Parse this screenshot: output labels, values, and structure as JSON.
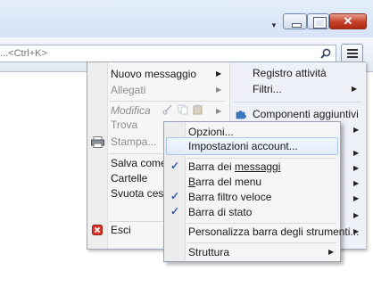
{
  "window": {
    "close_symbol": "✕"
  },
  "search": {
    "placeholder": "...<Ctrl+K>"
  },
  "menu": {
    "left": {
      "new_message": "Nuovo messaggio",
      "attachments": "Allegati",
      "edit": "Modifica",
      "find": "Trova",
      "print": "Stampa...",
      "save_as": "Salva come",
      "folders": "Cartelle",
      "empty_trash": "Svuota cestino",
      "exit": "Esci"
    },
    "right": {
      "activity_log": "Registro attività",
      "filters": "Filtri...",
      "addons": "Componenti aggiuntivi"
    }
  },
  "submenu": {
    "options": "Opzioni...",
    "account_settings": "Impostazioni account...",
    "message_bar_prefix": "Barra dei ",
    "message_bar_underlined": "messaggi",
    "menu_bar_underlined": "B",
    "menu_bar_rest": "arra del menu",
    "quick_filter_bar": "Barra filtro veloce",
    "status_bar": "Barra di stato",
    "customize_toolbar": "Personalizza barra degli strumenti...",
    "layout": "Struttura"
  },
  "icons": {
    "check": "✓",
    "submenu_arrow": "▶"
  }
}
